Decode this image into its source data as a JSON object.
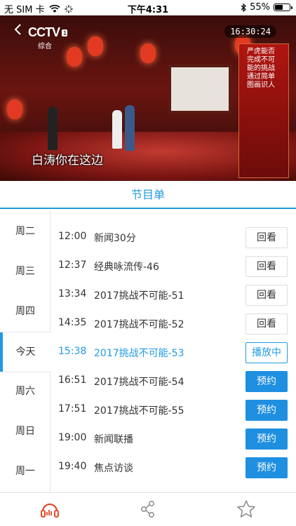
{
  "status_bar": {
    "carrier": "无 SIM 卡",
    "time": "下午4:31",
    "battery": "55%",
    "battery_level": 0.55
  },
  "player": {
    "channel_logo": "CCTV",
    "channel_number": "1",
    "channel_sub": "综合",
    "clock": "16:30:24",
    "subtitle": "白涛你在这边",
    "side_caption": "严虎能否完成不可能的挑战 通过简单图画识人"
  },
  "section": {
    "title": "节目单"
  },
  "days": [
    {
      "label": "周二",
      "active": false
    },
    {
      "label": "周三",
      "active": false
    },
    {
      "label": "周四",
      "active": false
    },
    {
      "label": "今天",
      "active": true
    },
    {
      "label": "周六",
      "active": false
    },
    {
      "label": "周日",
      "active": false
    },
    {
      "label": "周一",
      "active": false
    }
  ],
  "programs": [
    {
      "time": "12:00",
      "title": "新闻30分",
      "action": "回看",
      "state": "replay"
    },
    {
      "time": "12:37",
      "title": "经典咏流传-46",
      "action": "回看",
      "state": "replay"
    },
    {
      "time": "13:34",
      "title": "2017挑战不可能-51",
      "action": "回看",
      "state": "replay"
    },
    {
      "time": "14:35",
      "title": "2017挑战不可能-52",
      "action": "回看",
      "state": "replay"
    },
    {
      "time": "15:38",
      "title": "2017挑战不可能-53",
      "action": "播放中",
      "state": "playing"
    },
    {
      "time": "16:51",
      "title": "2017挑战不可能-54",
      "action": "预约",
      "state": "book"
    },
    {
      "time": "17:51",
      "title": "2017挑战不可能-55",
      "action": "预约",
      "state": "book"
    },
    {
      "time": "19:00",
      "title": "新闻联播",
      "action": "预约",
      "state": "book"
    },
    {
      "time": "19:40",
      "title": "焦点访谈",
      "action": "预约",
      "state": "book"
    }
  ],
  "bottom_bar": {
    "icons": [
      "listen-icon",
      "share-icon",
      "star-icon"
    ]
  },
  "colors": {
    "accent": "#1f9be2",
    "book_button": "#1f8fe0",
    "listen_icon": "#e04a2c"
  }
}
